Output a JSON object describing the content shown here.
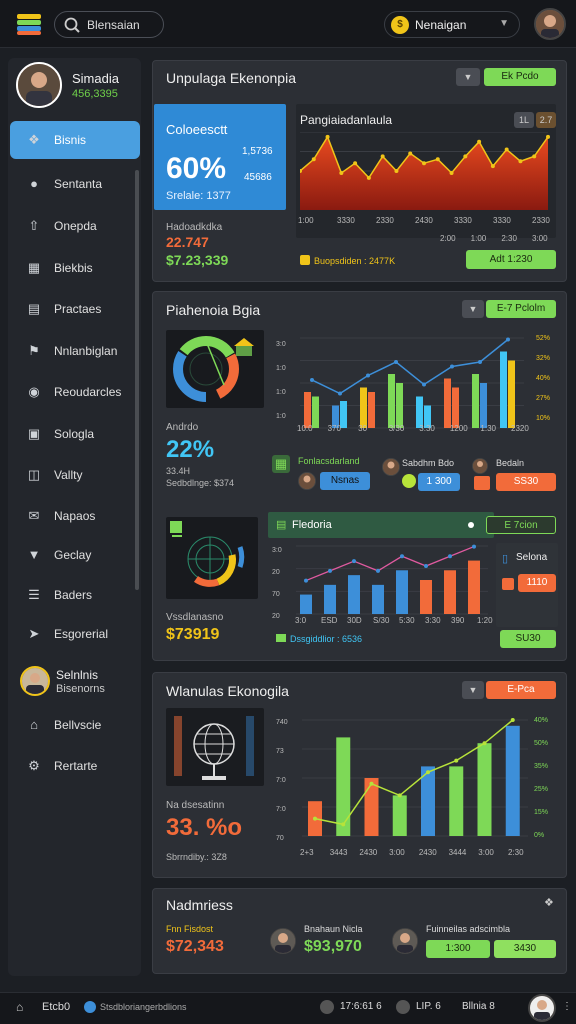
{
  "topbar": {
    "search_text": "Blensaian",
    "user_name": "Nenaigan"
  },
  "profile": {
    "name": "Simadia",
    "value": "456,3395"
  },
  "sidebar": {
    "items": [
      {
        "label": "Bisnis",
        "icon": "speech-bubble-icon"
      },
      {
        "label": "Sentanta",
        "icon": "location-pin-icon"
      },
      {
        "label": "Onepda",
        "icon": "upload-icon"
      },
      {
        "label": "Biekbis",
        "icon": "grid-icon"
      },
      {
        "label": "Practaes",
        "icon": "building-icon"
      },
      {
        "label": "Nnlanbiglan",
        "icon": "flag-icon"
      },
      {
        "label": "Reoudarcles",
        "icon": "globe-icon"
      },
      {
        "label": "Sologla",
        "icon": "briefcase-icon"
      },
      {
        "label": "Vallty",
        "icon": "report-icon"
      },
      {
        "label": "Napaos",
        "icon": "mail-icon"
      },
      {
        "label": "Geclay",
        "icon": "shield-icon"
      },
      {
        "label": "Baders",
        "icon": "list-icon"
      },
      {
        "label": "Esgorerial",
        "icon": "arrow-icon"
      }
    ],
    "user": {
      "line1": "Selnlnis",
      "line2": "Bisenorns"
    },
    "extra": [
      {
        "label": "Bellvscie",
        "icon": "home-icon"
      },
      {
        "label": "Rertarte",
        "icon": "settings-icon"
      }
    ]
  },
  "panel1": {
    "title": "Unpulaga Ekenonpia",
    "btn": "Ek Pcdo",
    "card": {
      "title": "Coloeesctt",
      "pct": "60%",
      "side1": "1,5736",
      "side2": "45686",
      "sub": "Srelale: 1377"
    },
    "stat_label": "Hadoadkdka",
    "stat1": "22.747",
    "stat2": "$7.23,339",
    "chart_title": "Pangiaiadanlaula",
    "chart_badge1": "1L",
    "chart_badge2": "2.7",
    "chart_xticks": [
      "1:00",
      "3330",
      "2330",
      "2430",
      "3330",
      "3330",
      "2330"
    ],
    "chart_xticks2": [
      "2:00",
      "1:00",
      "2:30",
      "3:00"
    ],
    "footer_text": "Buopsdiden : 2477K",
    "action": "Adt 1:230"
  },
  "panel2": {
    "title": "Piahenoia Bgia",
    "btn": "E-7 Pclolm",
    "stat_label": "Andrdo",
    "pct": "22%",
    "sub1": "33.4H",
    "sub2": "Sedbdlnge: $374",
    "chart_yticks_left": [
      "3:0",
      "1:0",
      "1:0",
      "1:0"
    ],
    "chart_yticks_right": [
      "52%",
      "32%",
      "40%",
      "27%",
      "10%"
    ],
    "chart_xticks": [
      "10:0",
      "370",
      "30",
      "3/30",
      "3:30",
      "1200",
      "1:30",
      "2320"
    ],
    "user1": {
      "name": "Fonlacsdarland",
      "action": "Nsnas"
    },
    "user2": {
      "name": "Sabdhm Bdo",
      "action": "1 300"
    },
    "user3": {
      "name": "Bedaln",
      "action": "SS30"
    },
    "inner_title": "Fledoria",
    "inner_btn": "E 7cion",
    "inner_stat_label": "Vssdlanasno",
    "inner_stat": "$73919",
    "inner_yticks": [
      "3:0",
      "20",
      "70",
      "20"
    ],
    "inner_xticks": [
      "3:0",
      "ESD",
      "30D",
      "S/30",
      "5:30",
      "3:30",
      "390",
      "1:20"
    ],
    "inner_footer": "Dssgiddlior : 6536",
    "side_title": "Selona",
    "side_btn1": "1110",
    "side_btn2": "SU30"
  },
  "panel3": {
    "title": "Wlanulas Ekonogila",
    "btn": "E-Pca",
    "stat_label": "Na dsesatinn",
    "pct": "33. %o",
    "sub": "Sbrrndiby.: 3Z8",
    "yticks_left": [
      "740",
      "73",
      "7:0",
      "7:0",
      "70"
    ],
    "yticks_right": [
      "40%",
      "50%",
      "35%",
      "25%",
      "15%",
      "0%"
    ],
    "xticks": [
      "2+3",
      "3443",
      "2430",
      "3:00",
      "2430",
      "3444",
      "3:00",
      "2:30"
    ]
  },
  "panel4": {
    "title": "Nadmriess",
    "label1": "Fnn Fisdost",
    "value1": "$72,343",
    "label2": "Bnahaun Nicla",
    "value2": "$93,970",
    "label3": "Fuinneilas adscimbla",
    "btn1": "1:300",
    "btn2": "3430"
  },
  "bottombar": {
    "left": "Etcb0",
    "mid": "Stsdbloriangerbdlions",
    "r1": "17:6:61 6",
    "r2": "LIP. 6",
    "r3": "Bllnia 8"
  },
  "colors": {
    "accent_blue": "#3d8fd9",
    "green": "#7ed957",
    "orange": "#f26b3a",
    "yellow": "#f0c419",
    "red": "#d93a1f"
  },
  "chart_data": [
    {
      "type": "area",
      "x": [
        "1:00",
        "3330",
        "2330",
        "2430",
        "3330",
        "3330",
        "2330"
      ],
      "series": [
        {
          "values": [
            40,
            52,
            75,
            38,
            48,
            33,
            55,
            40,
            58,
            48,
            52,
            38,
            55,
            70,
            45,
            62,
            50,
            55,
            75
          ]
        }
      ]
    },
    {
      "type": "bar",
      "categories": [
        "10:0",
        "370",
        "30",
        "3/30",
        "3:30",
        "1200",
        "1:30",
        "2320"
      ],
      "series": [
        {
          "values": [
            40,
            25,
            45,
            60,
            35,
            55,
            60,
            85
          ]
        },
        {
          "values": [
            35,
            30,
            40,
            50,
            25,
            45,
            50,
            75
          ]
        }
      ]
    },
    {
      "type": "bar",
      "categories": [
        "3:0",
        "ESD",
        "30D",
        "S/30",
        "5:30",
        "3:30",
        "390",
        "1:20"
      ],
      "series": [
        {
          "values": [
            20,
            30,
            40,
            30,
            45,
            35,
            45,
            55
          ]
        }
      ]
    },
    {
      "type": "bar",
      "categories": [
        "2+3",
        "3443",
        "2430",
        "3:00",
        "2430",
        "3444",
        "3:00",
        "2:30"
      ],
      "series": [
        {
          "values": [
            30,
            85,
            50,
            35,
            60,
            60,
            80,
            95
          ]
        }
      ]
    }
  ]
}
